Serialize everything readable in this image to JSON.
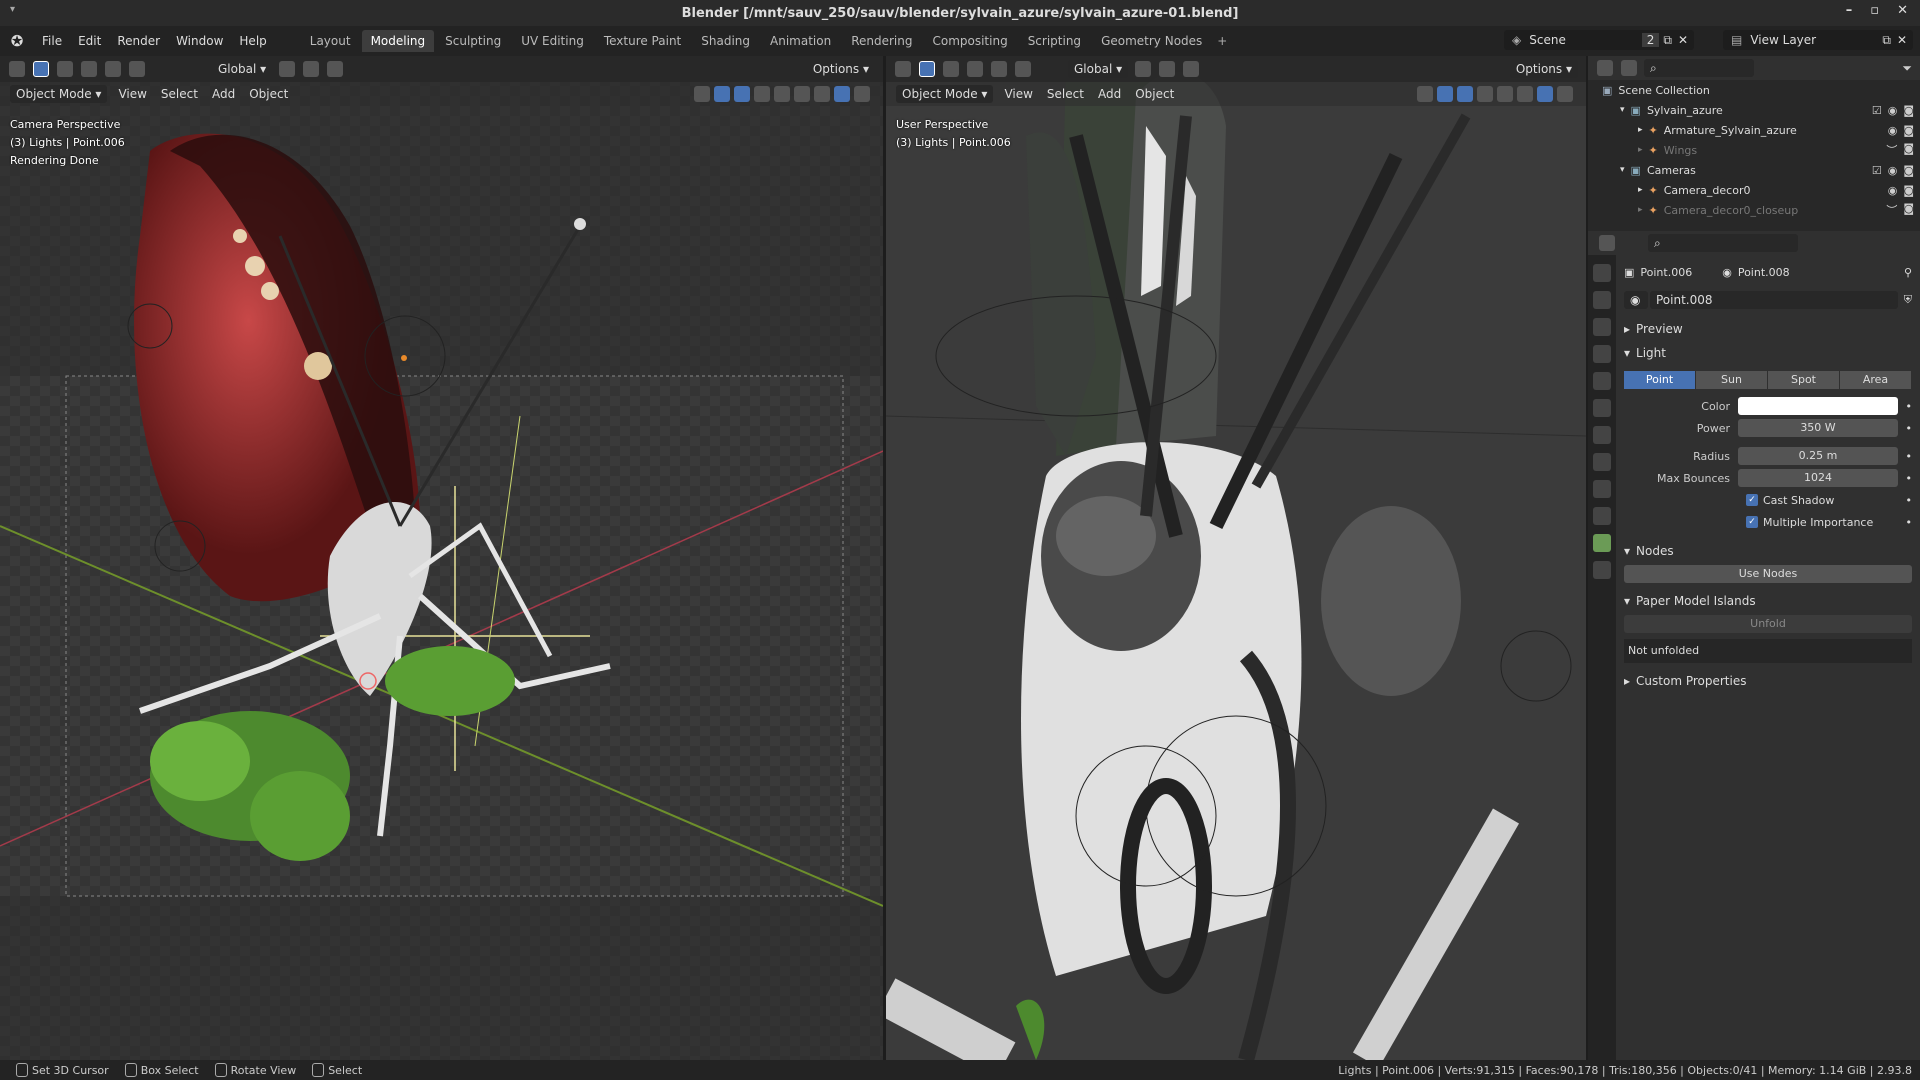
{
  "window": {
    "title": "Blender [/mnt/sauv_250/sauv/blender/sylvain_azure/sylvain_azure-01.blend]"
  },
  "menu": [
    "File",
    "Edit",
    "Render",
    "Window",
    "Help"
  ],
  "workspaces": [
    "Layout",
    "Modeling",
    "Sculpting",
    "UV Editing",
    "Texture Paint",
    "Shading",
    "Animation",
    "Rendering",
    "Compositing",
    "Scripting",
    "Geometry Nodes"
  ],
  "active_workspace": "Modeling",
  "scene": {
    "name": "Scene",
    "count": "2",
    "view_layer": "View Layer"
  },
  "viewport_left": {
    "orientation": "Global",
    "options": "Options",
    "mode": "Object Mode",
    "menus": [
      "View",
      "Select",
      "Add",
      "Object"
    ],
    "info": [
      "Camera Perspective",
      "(3) Lights | Point.006",
      "Rendering Done"
    ]
  },
  "viewport_right": {
    "orientation": "Global",
    "options": "Options",
    "mode": "Object Mode",
    "menus": [
      "View",
      "Select",
      "Add",
      "Object"
    ],
    "info": [
      "User Perspective",
      "(3) Lights | Point.006"
    ]
  },
  "outliner": {
    "root": "Scene Collection",
    "rows": [
      {
        "label": "Sylvain_azure",
        "indent": 1,
        "dim": false
      },
      {
        "label": "Armature_Sylvain_azure",
        "indent": 2,
        "dim": false
      },
      {
        "label": "Wings",
        "indent": 2,
        "dim": true
      },
      {
        "label": "Cameras",
        "indent": 1,
        "dim": false
      },
      {
        "label": "Camera_decor0",
        "indent": 2,
        "dim": false
      },
      {
        "label": "Camera_decor0_closeup",
        "indent": 2,
        "dim": true
      }
    ]
  },
  "properties": {
    "object": "Point.006",
    "data": "Point.008",
    "datablock": "Point.008",
    "preview": "Preview",
    "light_panel": "Light",
    "light_types": [
      "Point",
      "Sun",
      "Spot",
      "Area"
    ],
    "active_type": "Point",
    "color_label": "Color",
    "color": "#ffffff",
    "power_label": "Power",
    "power": "350 W",
    "radius_label": "Radius",
    "radius": "0.25 m",
    "bounces_label": "Max Bounces",
    "bounces": "1024",
    "cast_shadow": "Cast Shadow",
    "multiple_importance": "Multiple Importance",
    "nodes_panel": "Nodes",
    "use_nodes": "Use Nodes",
    "paper_panel": "Paper Model Islands",
    "unfold": "Unfold",
    "not_unfolded": "Not unfolded",
    "custom_panel": "Custom Properties"
  },
  "status": {
    "left": [
      {
        "icon": "mouse-left-icon",
        "label": "Set 3D Cursor"
      },
      {
        "icon": "mouse-left-icon",
        "label": "Box Select"
      },
      {
        "icon": "mouse-middle-icon",
        "label": "Rotate View"
      },
      {
        "icon": "mouse-right-icon",
        "label": "Select"
      }
    ],
    "right": "Lights | Point.006 | Verts:91,315 | Faces:90,178 | Tris:180,356 | Objects:0/41 | Memory: 1.14 GiB | 2.93.8"
  }
}
